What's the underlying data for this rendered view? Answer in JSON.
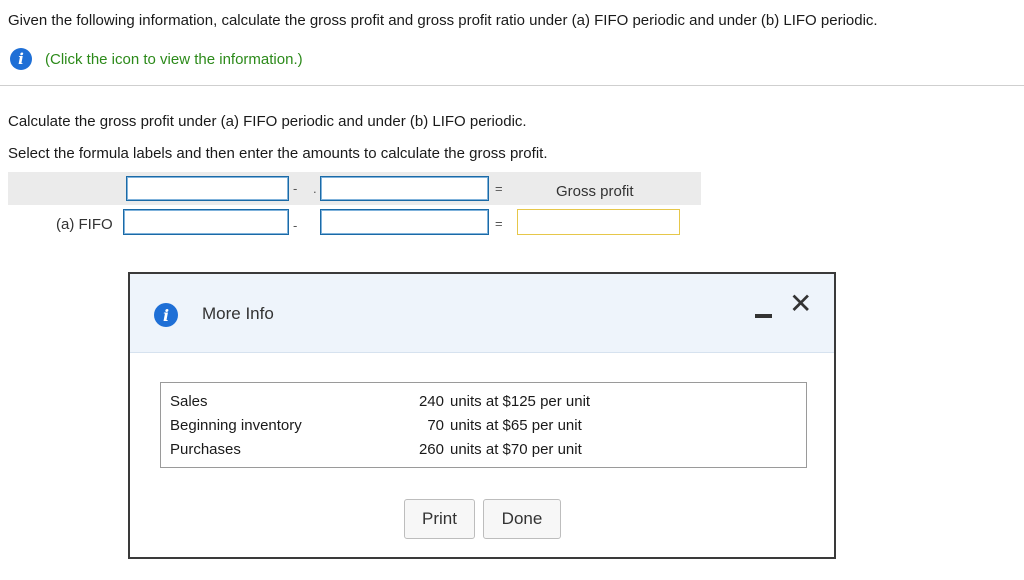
{
  "question": "Given the following information, calculate the gross profit and gross profit ratio under (a) FIFO periodic and under (b) LIFO periodic.",
  "info_icon": "info-circle-icon",
  "info_link": "(Click the icon to view the information.)",
  "instruction_1": "Calculate the gross profit under (a) FIFO periodic and under (b) LIFO periodic.",
  "instruction_2": "Select the formula labels and then enter the amounts to calculate the gross profit.",
  "formula": {
    "minus": "-",
    "equals": "=",
    "result_label": "Gross profit",
    "rows": [
      {
        "label": "(a) FIFO",
        "operand1": "",
        "operand2": "",
        "result": ""
      }
    ],
    "header_operand1": "",
    "header_operand2": ""
  },
  "dialog": {
    "title": "More Info",
    "minimize_icon": "minimize-icon",
    "close_icon": "close-icon",
    "rows": [
      {
        "label": "Sales",
        "qty": "240",
        "rest": "units at $125 per unit"
      },
      {
        "label": "Beginning inventory",
        "qty": "70",
        "rest": "units at $65 per unit"
      },
      {
        "label": "Purchases",
        "qty": "260",
        "rest": "units at $70 per unit"
      }
    ],
    "print_label": "Print",
    "done_label": "Done"
  },
  "colors": {
    "info_blue": "#1e6fd6",
    "link_green": "#2c8a1a",
    "field_border": "#1b6aa6",
    "result_border": "#e6c74a",
    "dialog_header": "#eef4fb"
  }
}
